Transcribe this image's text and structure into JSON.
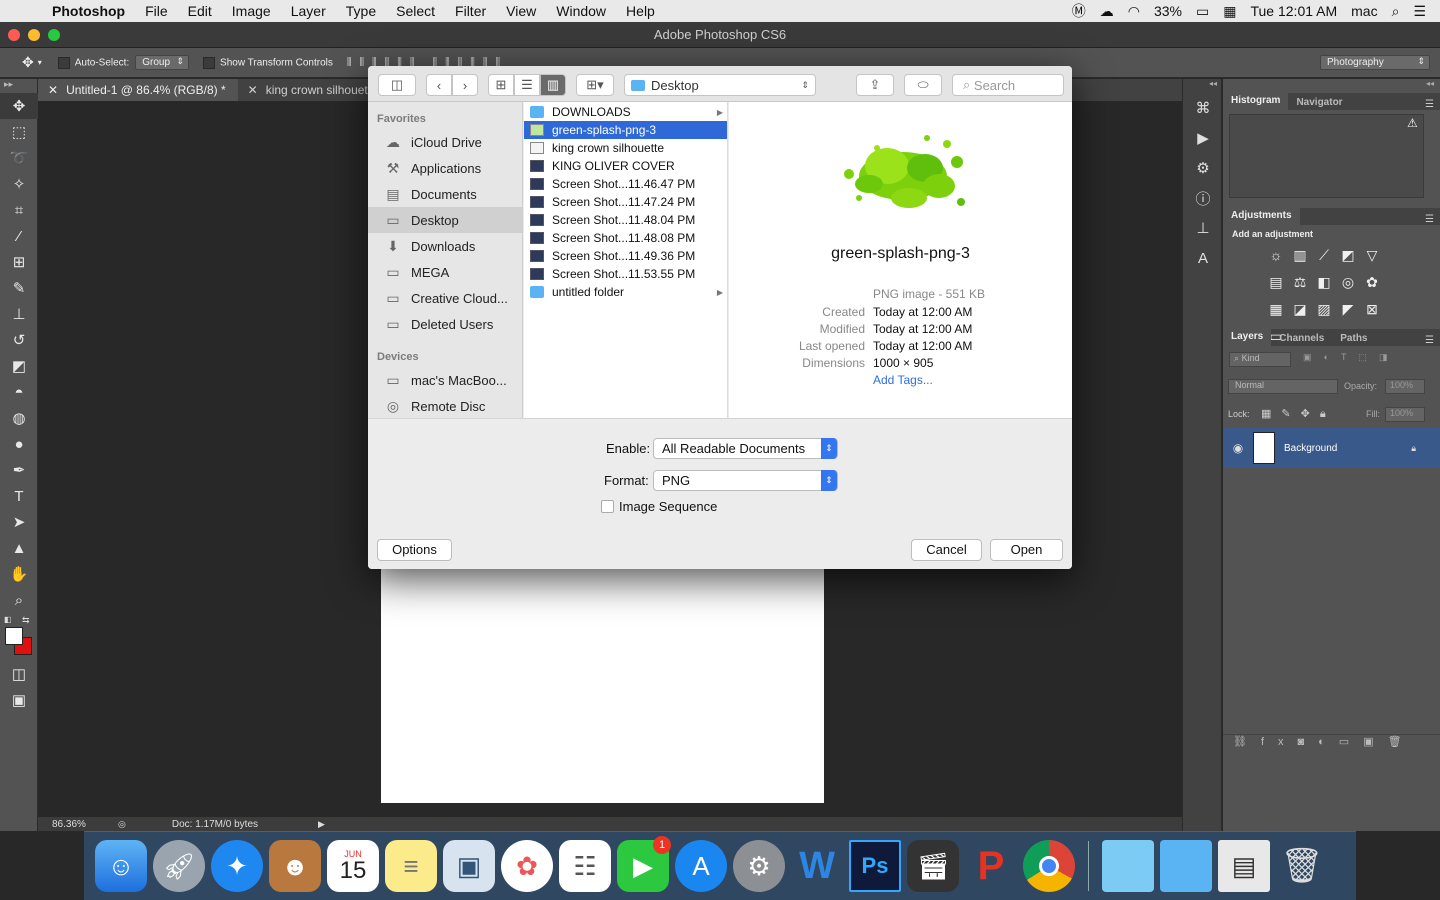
{
  "menubar": {
    "app": "Photoshop",
    "items": [
      "File",
      "Edit",
      "Image",
      "Layer",
      "Type",
      "Select",
      "Filter",
      "View",
      "Window",
      "Help"
    ],
    "battery": "33%",
    "clock": "Tue 12:01 AM",
    "user": "mac"
  },
  "window": {
    "title": "Adobe Photoshop CS6"
  },
  "options": {
    "auto_select": "Auto-Select:",
    "group": "Group",
    "transform": "Show Transform Controls",
    "workspace": "Photography"
  },
  "tabs": [
    {
      "label": "Untitled-1 @ 86.4% (RGB/8) *"
    },
    {
      "label": "king crown silhouette.jp"
    }
  ],
  "status": {
    "zoom": "86.36%",
    "doc": "Doc: 1.17M/0 bytes"
  },
  "panels": {
    "histogram": "Histogram",
    "navigator": "Navigator",
    "adjustments": "Adjustments",
    "add_adjustment": "Add an adjustment",
    "layers": "Layers",
    "channels": "Channels",
    "paths": "Paths",
    "kind": "Kind",
    "blend": "Normal",
    "opacity_label": "Opacity:",
    "opacity": "100%",
    "lock": "Lock:",
    "fill_label": "Fill:",
    "fill": "100%",
    "layer_name": "Background"
  },
  "dialog": {
    "location": "Desktop",
    "search": "Search",
    "favorites_header": "Favorites",
    "favorites": [
      {
        "label": "iCloud Drive",
        "icon": "cloud"
      },
      {
        "label": "Applications",
        "icon": "apps"
      },
      {
        "label": "Documents",
        "icon": "doc"
      },
      {
        "label": "Desktop",
        "icon": "desktop"
      },
      {
        "label": "Downloads",
        "icon": "download"
      },
      {
        "label": "MEGA",
        "icon": "folder"
      },
      {
        "label": "Creative Cloud...",
        "icon": "folder"
      },
      {
        "label": "Deleted Users",
        "icon": "folder"
      }
    ],
    "devices_header": "Devices",
    "devices": [
      {
        "label": "mac's MacBoo...",
        "icon": "laptop"
      },
      {
        "label": "Remote Disc",
        "icon": "disc"
      }
    ],
    "files": [
      {
        "name": "DOWNLOADS",
        "kind": "folder"
      },
      {
        "name": "green-splash-png-3",
        "kind": "img"
      },
      {
        "name": "king crown silhouette",
        "kind": "img"
      },
      {
        "name": "KING OLIVER COVER",
        "kind": "dark"
      },
      {
        "name": "Screen Shot...11.46.47 PM",
        "kind": "dark"
      },
      {
        "name": "Screen Shot...11.47.24 PM",
        "kind": "dark"
      },
      {
        "name": "Screen Shot...11.48.04 PM",
        "kind": "dark"
      },
      {
        "name": "Screen Shot...11.48.08 PM",
        "kind": "dark"
      },
      {
        "name": "Screen Shot...11.49.36 PM",
        "kind": "dark"
      },
      {
        "name": "Screen Shot...11.53.55 PM",
        "kind": "dark"
      },
      {
        "name": "untitled folder",
        "kind": "folder"
      }
    ],
    "preview": {
      "name": "green-splash-png-3",
      "type": "PNG image - 551 KB",
      "created_label": "Created",
      "created": "Today at 12:00 AM",
      "modified_label": "Modified",
      "modified": "Today at 12:00 AM",
      "opened_label": "Last opened",
      "opened": "Today at 12:00 AM",
      "dims_label": "Dimensions",
      "dims": "1000 × 905",
      "tags": "Add Tags..."
    },
    "enable_label": "Enable:",
    "enable": "All Readable Documents",
    "format_label": "Format:",
    "format": "PNG",
    "sequence": "Image Sequence",
    "options": "Options",
    "cancel": "Cancel",
    "open": "Open"
  },
  "dock": {
    "calendar_month": "JUN",
    "calendar_day": "15",
    "facetime_badge": "1",
    "ps_label": "Ps"
  },
  "colors": {
    "selection": "#2f69d7",
    "accent": "#3476ef",
    "splash": "#7dd10c"
  }
}
